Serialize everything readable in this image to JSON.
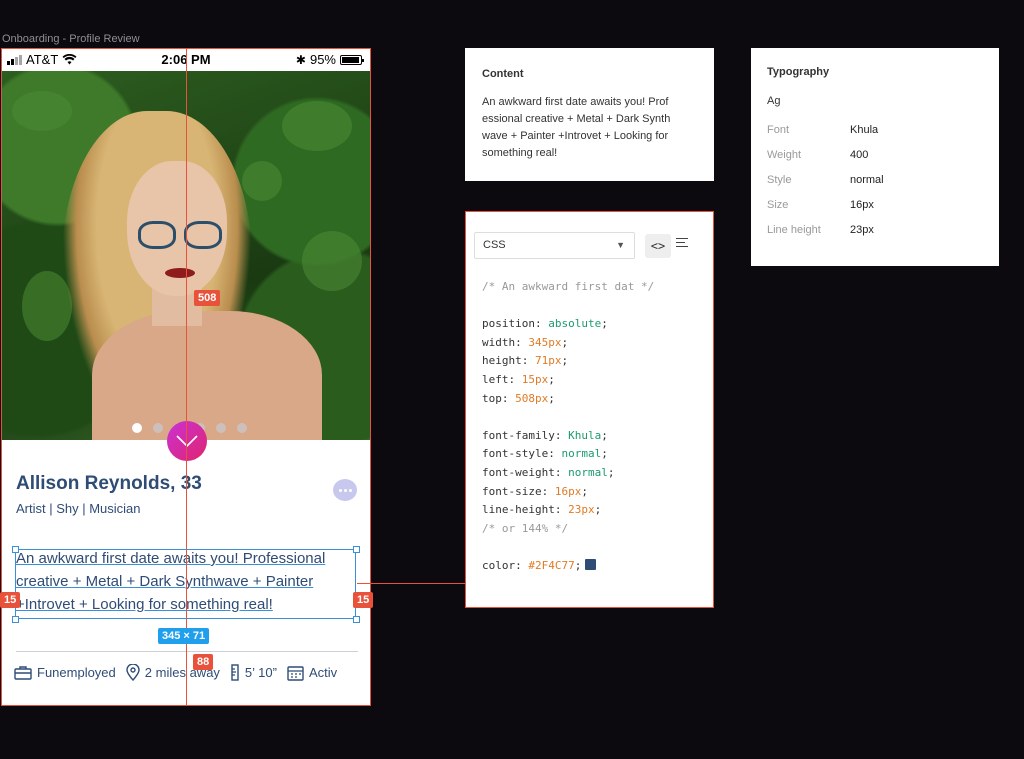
{
  "frame_title": "Onboarding - Profile Review",
  "status": {
    "carrier": "AT&T",
    "time": "2:06 PM",
    "battery": "95%",
    "battery_level": 0.95
  },
  "profile": {
    "name": "Allison Reynolds, 33",
    "tags": "Artist | Shy | Musician",
    "bio": "An awkward first date awaits you! Professional creative + Metal + Dark Synthwave + Painter +Introvet + Looking for something real!",
    "photo_count": 6,
    "active_photo": 1,
    "meta": [
      {
        "icon": "briefcase-icon",
        "label": "Funemployed"
      },
      {
        "icon": "location-pin-icon",
        "label": "2 miles away"
      },
      {
        "icon": "ruler-icon",
        "label": "5’ 10”"
      },
      {
        "icon": "calendar-icon",
        "label": "Activ"
      }
    ]
  },
  "measure": {
    "top": "508",
    "left": "15",
    "right": "15",
    "size": "345 × 71",
    "bottom": "88"
  },
  "content_panel": {
    "title": "Content",
    "text": "An awkward first date awaits you! Prof essional creative + Metal + Dark Synth wave + Painter +Introvet + Looking for something real!"
  },
  "typography_panel": {
    "title": "Typography",
    "sample": "Ag",
    "rows": [
      {
        "k": "Font",
        "v": "Khula"
      },
      {
        "k": "Weight",
        "v": "400"
      },
      {
        "k": "Style",
        "v": "normal"
      },
      {
        "k": "Size",
        "v": "16px"
      },
      {
        "k": "Line height",
        "v": "23px"
      }
    ]
  },
  "css_panel": {
    "select": "CSS",
    "code_button": "<>",
    "comment": "/* An awkward first dat */",
    "lines": [
      {
        "prop": "position",
        "val": "absolute",
        "kind": "kw"
      },
      {
        "prop": "width",
        "val": "345px",
        "kind": "num"
      },
      {
        "prop": "height",
        "val": "71px",
        "kind": "num"
      },
      {
        "prop": "left",
        "val": "15px",
        "kind": "num"
      },
      {
        "prop": "top",
        "val": "508px",
        "kind": "num"
      }
    ],
    "font_lines": [
      {
        "prop": "font-family",
        "val": "Khula",
        "kind": "kw"
      },
      {
        "prop": "font-style",
        "val": "normal",
        "kind": "kw"
      },
      {
        "prop": "font-weight",
        "val": "normal",
        "kind": "kw"
      },
      {
        "prop": "font-size",
        "val": "16px",
        "kind": "num"
      },
      {
        "prop": "line-height",
        "val": "23px",
        "kind": "num"
      }
    ],
    "lh_comment": "/* or 144% */",
    "color_prop": "color",
    "color_val": "#2F4C77"
  },
  "colors": {
    "accent": "#e8513a",
    "text": "#2f4c77",
    "selection": "#3a8fd8"
  }
}
